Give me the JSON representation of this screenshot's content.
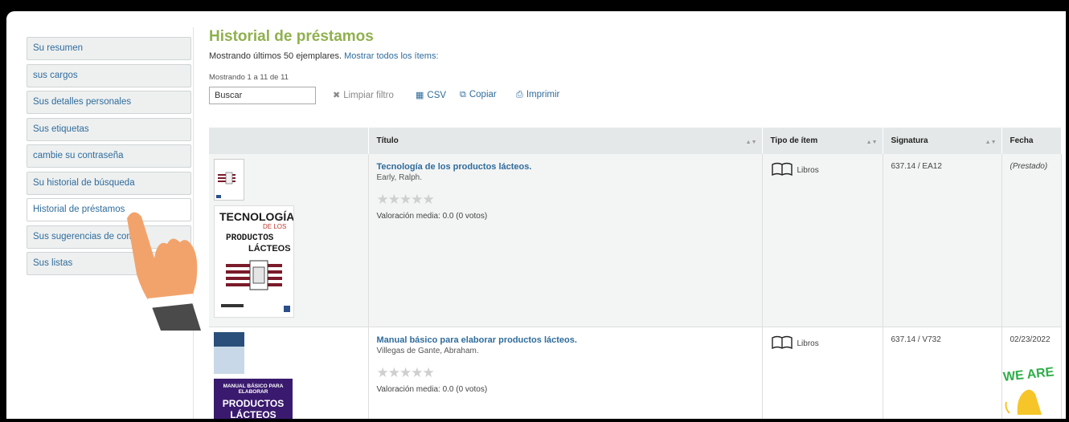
{
  "sidebar": {
    "items": [
      {
        "label": "Su resumen"
      },
      {
        "label": "sus cargos"
      },
      {
        "label": "Sus detalles personales"
      },
      {
        "label": "Sus etiquetas"
      },
      {
        "label": "cambie su contraseña"
      },
      {
        "label": "Su historial de búsqueda"
      },
      {
        "label": "Historial de préstamos",
        "active": true
      },
      {
        "label": "Sus sugerencias de compra"
      },
      {
        "label": "Sus listas"
      }
    ]
  },
  "main": {
    "title": "Historial de préstamos",
    "info_text": "Mostrando últimos 50 ejemplares.",
    "info_link": "Mostrar todos los ítems:",
    "counter": "Mostrando 1 a 11 de 11",
    "search_placeholder": "Buscar",
    "clear_filter": "Limpiar filtro",
    "csv": "CSV",
    "copy": "Copiar",
    "print": "Imprimir"
  },
  "table": {
    "headers": [
      "",
      "Título",
      "Tipo de ítem",
      "Signatura",
      "Fecha"
    ],
    "rows": [
      {
        "title": "Tecnología de los productos lácteos.",
        "author": "Early, Ralph.",
        "rating": "Valoración media: 0.0 (0 votos)",
        "type": "Libros",
        "call_number": "637.14 / EA12",
        "date": "(Prestado)",
        "cover_text": [
          "TECNOLOGÍA",
          "DE LOS",
          "PRODUCTOS",
          "LÁCTEOS"
        ]
      },
      {
        "title": "Manual básico para elaborar productos lácteos.",
        "author": "Villegas de Gante, Abraham.",
        "rating": "Valoración media: 0.0 (0 votos)",
        "type": "Libros",
        "call_number": "637.14 / V732",
        "date": "02/23/2022",
        "cover_text": [
          "MANUAL BÁSICO PARA ELABORAR",
          "PRODUCTOS LÁCTEOS"
        ]
      }
    ]
  },
  "overlay": {
    "sticker_text": "WE ARE"
  },
  "colors": {
    "title_green": "#8fb04e",
    "link_blue": "#2f6c9c",
    "header_gray": "#e5e8e8"
  }
}
